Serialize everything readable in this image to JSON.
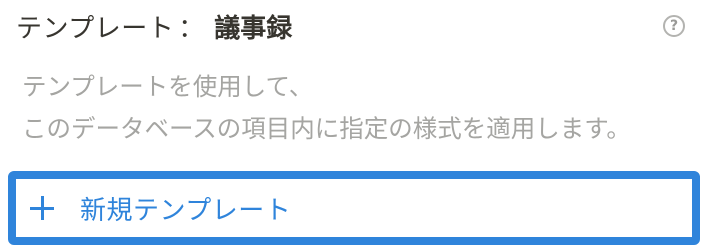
{
  "header": {
    "label": "テンプレート",
    "separator": "：",
    "value": "議事録",
    "help_symbol": "?"
  },
  "description": {
    "line1": "テンプレートを使用して、",
    "line2": "このデータベースの項目内に指定の様式を適用します。"
  },
  "new_template_button": {
    "label": "新規テンプレート",
    "icon": "plus-icon"
  },
  "colors": {
    "accent": "#2f84db",
    "text_primary": "#37352f",
    "text_secondary": "#a5a5a2"
  }
}
